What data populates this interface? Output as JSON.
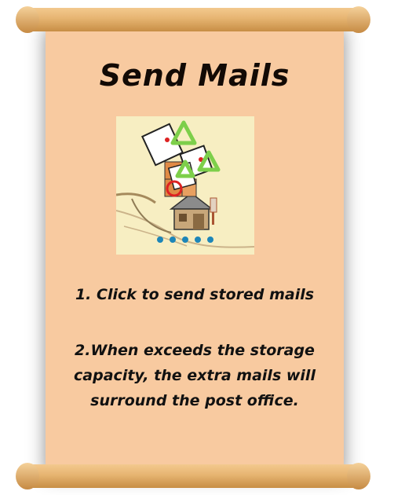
{
  "dialog": {
    "title": "Send Mails",
    "steps": [
      "1. Click to send stored mails",
      "2.When exceeds the storage capacity, the extra mails will surround the post office."
    ]
  },
  "illustration": {
    "icons": [
      "mail-envelope-icon",
      "upgrade-arrow-icon",
      "post-office-icon"
    ],
    "page_indicator": {
      "dots": 5,
      "active_index": 0
    }
  },
  "colors": {
    "parchment": "#f8caa0",
    "rod": "#e6b471",
    "arrow_green": "#7dcf4a",
    "dot_blue": "#1d86b8"
  }
}
